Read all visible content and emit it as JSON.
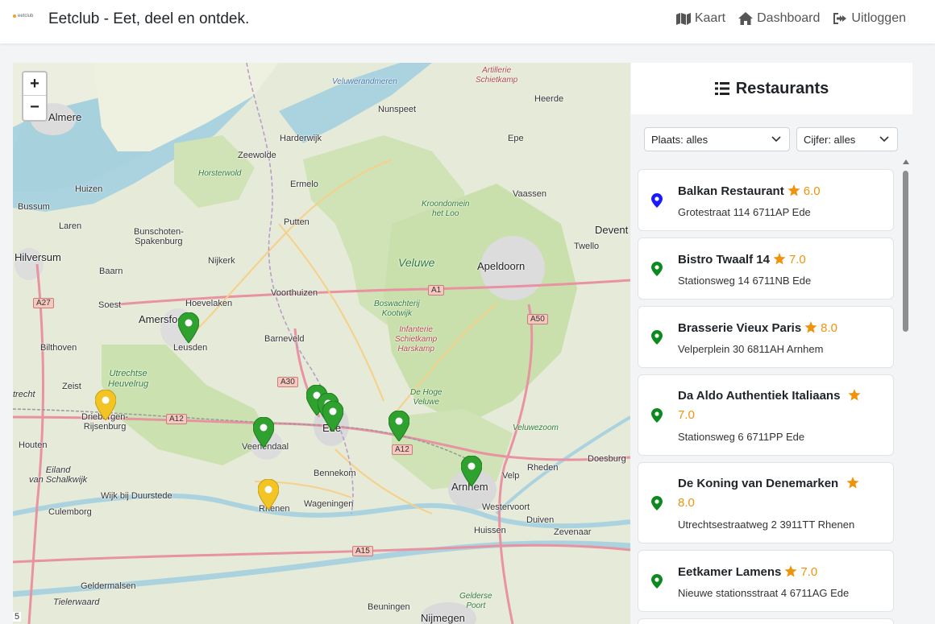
{
  "app": {
    "logo_text": "eetclub",
    "brand": "Eetclub - Eet, deel en ontdek."
  },
  "nav": {
    "items": [
      {
        "label": "Kaart",
        "icon": "map-icon"
      },
      {
        "label": "Dashboard",
        "icon": "home-icon"
      },
      {
        "label": "Uitloggen",
        "icon": "sign-out-icon"
      }
    ]
  },
  "map": {
    "zoom_in": "+",
    "zoom_out": "−",
    "places": [
      "Almere",
      "Huizen",
      "Bussum",
      "Laren",
      "Hilversum",
      "Baarn",
      "Soest",
      "Bilthoven",
      "Zeist",
      "trecht",
      "Houten",
      "Driebergen-\nRijsenburg",
      "Amersfoort",
      "Leusden",
      "Hoevelaken",
      "Nijkerk",
      "Bunschoten-\nSpakenburg",
      "Harderwijk",
      "Zeewolde",
      "Ermelo",
      "Putten",
      "Voorthuizen",
      "Barneveld",
      "Veenendaal",
      "Ede",
      "Bennekom",
      "Wageningen",
      "Rhenen",
      "Wijk bij Duurstede",
      "Culemborg",
      "Arnhem",
      "Nunspeet",
      "Epe",
      "Heerde",
      "Vaassen",
      "Apeldoorn",
      "Twello",
      "Devent",
      "Velp",
      "Rheden",
      "Doesburg",
      "Westervoort",
      "Huissen",
      "Duiven",
      "Zevenaar",
      "Geldermalsen",
      "Tielerwaard",
      "Nijmegen",
      "Beuningen",
      "Eiland\nvan Schalkwijk"
    ],
    "green_labels": [
      "Veluwe",
      "Horsterwold",
      "Kroondomein\nhet Loo",
      "Utrechtse\nHeuvelrug",
      "Boswachterij\nKootwijk",
      "De Hoge\nVeluwe",
      "Veluwezoom",
      "Gelderse\nPoort"
    ],
    "water_labels": [
      "Veluwerandmeren"
    ],
    "military_labels": [
      "Artillerie\nSchietkamp",
      "Infanterie\nSchietkamp\nHarskamp"
    ],
    "roads": [
      "A1",
      "A50",
      "A30",
      "A12",
      "A12",
      "A27",
      "A15"
    ],
    "attribution_fragment": "5"
  },
  "panel": {
    "title": "Restaurants",
    "filter_place": "Plaats: alles",
    "filter_rating": "Cijfer: alles",
    "restaurants": [
      {
        "name": "Balkan Restaurant",
        "rating": "6.0",
        "address": "Grotestraat 114 6711AP Ede",
        "marker_color": "#1a1aff"
      },
      {
        "name": "Bistro Twaalf 14",
        "rating": "7.0",
        "address": "Stationsweg 14 6711NB Ede",
        "marker_color": "#0d8a1f"
      },
      {
        "name": "Brasserie Vieux Paris",
        "rating": "8.0",
        "address": "Velperplein 30 6811AH Arnhem",
        "marker_color": "#0d8a1f"
      },
      {
        "name": "Da Aldo Authentiek Italiaans",
        "rating": "7.0",
        "address": "Stationsweg 6 6711PP Ede",
        "marker_color": "#0d8a1f"
      },
      {
        "name": "De Koning van Denemarken",
        "rating": "8.0",
        "address": "Utrechtsestraatweg 2 3911TT Rhenen",
        "marker_color": "#0d8a1f"
      },
      {
        "name": "Eetkamer Lamens",
        "rating": "7.0",
        "address": "Nieuwe stationsstraat 4 6711AG Ede",
        "marker_color": "#0d8a1f"
      }
    ]
  },
  "colors": {
    "accent_star": "#f0930c",
    "marker_green": "#2ea12e",
    "marker_yellow": "#f2c525",
    "marker_blue": "#1a1aff"
  }
}
